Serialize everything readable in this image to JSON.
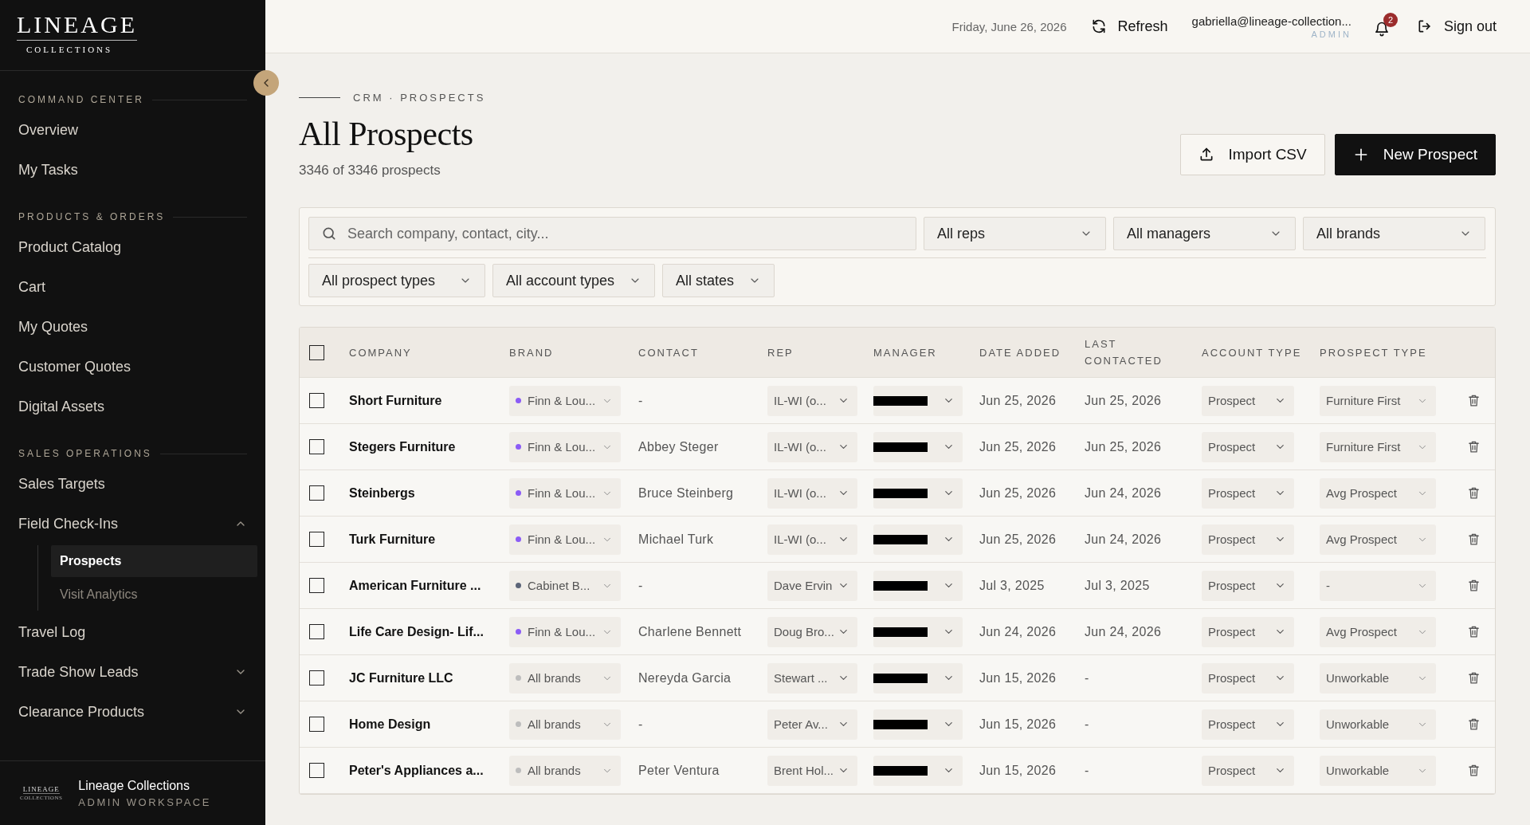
{
  "sidebar": {
    "logo_main": "LINEAGE",
    "logo_sub": "COLLECTIONS",
    "sections": [
      {
        "title": "COMMAND CENTER",
        "items": [
          {
            "label": "Overview"
          },
          {
            "label": "My Tasks"
          }
        ]
      },
      {
        "title": "PRODUCTS & ORDERS",
        "items": [
          {
            "label": "Product Catalog"
          },
          {
            "label": "Cart"
          },
          {
            "label": "My Quotes"
          },
          {
            "label": "Customer Quotes"
          },
          {
            "label": "Digital Assets"
          }
        ]
      },
      {
        "title": "SALES OPERATIONS",
        "items": [
          {
            "label": "Sales Targets"
          },
          {
            "label": "Field Check-Ins",
            "expanded": true,
            "children": [
              {
                "label": "Prospects",
                "selected": true
              },
              {
                "label": "Visit Analytics",
                "selected": false
              }
            ]
          },
          {
            "label": "Travel Log"
          },
          {
            "label": "Trade Show Leads",
            "expanded": false
          },
          {
            "label": "Clearance Products",
            "expanded": false
          }
        ]
      }
    ],
    "footer": {
      "logo_main": "LINEAGE",
      "logo_sub": "COLLECTIONS",
      "name": "Lineage Collections",
      "role": "ADMIN WORKSPACE"
    }
  },
  "topbar": {
    "date": "Friday, June 26, 2026",
    "refresh": "Refresh",
    "user": "gabriella@lineage-collection...",
    "role": "ADMIN",
    "notifications": "2",
    "sign_out": "Sign out"
  },
  "page": {
    "breadcrumb": "CRM · PROSPECTS",
    "title": "All Prospects",
    "count": "3346 of 3346 prospects",
    "buttons": [
      {
        "label": "Import CSV",
        "kind": "secondary"
      },
      {
        "label": "New Prospect",
        "kind": "primary"
      }
    ]
  },
  "filters": {
    "search": {
      "placeholder": "Search company, contact, city..."
    },
    "row_1": [
      "All reps",
      "All managers",
      "All brands"
    ],
    "row_2": [
      "All prospect types",
      "All account types",
      "All states"
    ]
  },
  "table": {
    "select_all_checked": false,
    "columns": [
      "COMPANY",
      "BRAND",
      "CONTACT",
      "REP",
      "MANAGER",
      "DATE ADDED",
      "LAST CONTACTED",
      "ACCOUNT TYPE",
      "PROSPECT TYPE"
    ],
    "rows": [
      {
        "checked": false,
        "company": "Short Furniture",
        "brand": {
          "label": "Finn & Lou...",
          "color": "#8b5cf6"
        },
        "contact": "-",
        "rep": "IL-WI (o...",
        "manager_redacted": true,
        "date_added": "Jun 25, 2026",
        "last_contacted": "Jun 25, 2026",
        "account_type": "Prospect",
        "prospect_type": "Furniture First"
      },
      {
        "checked": false,
        "company": "Stegers Furniture",
        "brand": {
          "label": "Finn & Lou...",
          "color": "#8b5cf6"
        },
        "contact": "Abbey Steger",
        "rep": "IL-WI (o...",
        "manager_redacted": true,
        "date_added": "Jun 25, 2026",
        "last_contacted": "Jun 25, 2026",
        "account_type": "Prospect",
        "prospect_type": "Furniture First"
      },
      {
        "checked": false,
        "company": "Steinbergs",
        "brand": {
          "label": "Finn & Lou...",
          "color": "#8b5cf6"
        },
        "contact": "Bruce Steinberg",
        "rep": "IL-WI (o...",
        "manager_redacted": true,
        "date_added": "Jun 25, 2026",
        "last_contacted": "Jun 24, 2026",
        "account_type": "Prospect",
        "prospect_type": "Avg Prospect"
      },
      {
        "checked": false,
        "company": "Turk Furniture",
        "brand": {
          "label": "Finn & Lou...",
          "color": "#8b5cf6"
        },
        "contact": "Michael Turk",
        "rep": "IL-WI (o...",
        "manager_redacted": true,
        "date_added": "Jun 25, 2026",
        "last_contacted": "Jun 24, 2026",
        "account_type": "Prospect",
        "prospect_type": "Avg Prospect"
      },
      {
        "checked": false,
        "company": "American Furniture ...",
        "brand": {
          "label": "Cabinet B...",
          "color": "#5b6478"
        },
        "contact": "-",
        "rep": "Dave Ervin",
        "manager_redacted": true,
        "date_added": "Jul 3, 2025",
        "last_contacted": "Jul 3, 2025",
        "account_type": "Prospect",
        "prospect_type": "-"
      },
      {
        "checked": false,
        "company": "Life Care Design- Lif...",
        "brand": {
          "label": "Finn & Lou...",
          "color": "#8b5cf6"
        },
        "contact": "Charlene Bennett",
        "rep": "Doug Bro...",
        "manager_redacted": true,
        "date_added": "Jun 24, 2026",
        "last_contacted": "Jun 24, 2026",
        "account_type": "Prospect",
        "prospect_type": "Avg Prospect"
      },
      {
        "checked": false,
        "company": "JC Furniture LLC",
        "brand": {
          "label": "All brands",
          "color": "#bdbdbd"
        },
        "contact": "Nereyda Garcia",
        "rep": "Stewart ...",
        "manager_redacted": true,
        "date_added": "Jun 15, 2026",
        "last_contacted": "-",
        "account_type": "Prospect",
        "prospect_type": "Unworkable"
      },
      {
        "checked": false,
        "company": "Home Design",
        "brand": {
          "label": "All brands",
          "color": "#bdbdbd"
        },
        "contact": "-",
        "rep": "Peter Av...",
        "manager_redacted": true,
        "date_added": "Jun 15, 2026",
        "last_contacted": "-",
        "account_type": "Prospect",
        "prospect_type": "Unworkable"
      },
      {
        "checked": false,
        "company": "Peter's Appliances a...",
        "brand": {
          "label": "All brands",
          "color": "#bdbdbd"
        },
        "contact": "Peter Ventura",
        "rep": "Brent Hol...",
        "manager_redacted": true,
        "date_added": "Jun 15, 2026",
        "last_contacted": "-",
        "account_type": "Prospect",
        "prospect_type": "Unworkable"
      }
    ]
  }
}
